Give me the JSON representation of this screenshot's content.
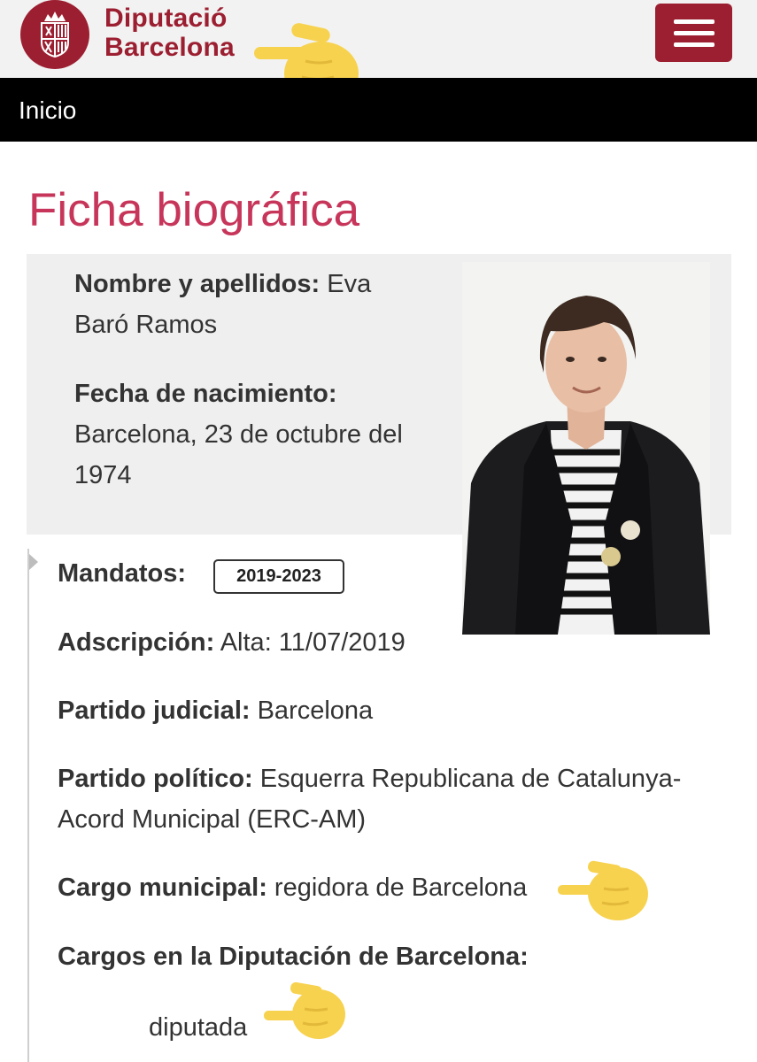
{
  "header": {
    "brand_line1": "Diputació",
    "brand_line2": "Barcelona",
    "menu_icon": "hamburger-icon",
    "brand_color": "#9c1f31"
  },
  "nav": {
    "home_label": "Inicio"
  },
  "page": {
    "title": "Ficha biográfica",
    "title_color": "#c7365a"
  },
  "bio": {
    "name_label": "Nombre y apellidos:",
    "name_value_line1": "Eva",
    "name_value_line2": "Baró Ramos",
    "birth_label": "Fecha de nacimiento:",
    "birth_value_line1": "Barcelona, 23 de octubre del",
    "birth_value_line2": "1974"
  },
  "details": {
    "mandates_label": "Mandatos:",
    "mandate_badge": "2019-2023",
    "ascription_label": "Adscripción:",
    "ascription_value": "Alta: 11/07/2019",
    "judicial_label": "Partido judicial:",
    "judicial_value": "Barcelona",
    "party_label": "Partido político:",
    "party_value_line1": "Esquerra Republicana de Catalunya-",
    "party_value_line2": "Acord Municipal (ERC-AM)",
    "municipal_label": "Cargo municipal:",
    "municipal_value": "regidora de Barcelona",
    "dipu_label": "Cargos en la Diputación de Barcelona:",
    "dipu_value": "diputada"
  },
  "annotations": {
    "pointer_icon": "pointing-hand-emoji",
    "pointer_color": "#f7d24f"
  }
}
